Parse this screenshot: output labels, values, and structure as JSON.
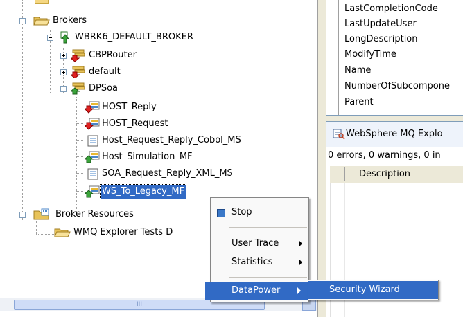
{
  "tree": {
    "brokers_label": "Brokers",
    "broker_name": "WBRK6_DEFAULT_BROKER",
    "groups": [
      "CBPRouter",
      "default",
      "DPSoa"
    ],
    "flows": [
      "HOST_Reply",
      "HOST_Request",
      "Host_Request_Reply_Cobol_MS",
      "Host_Simulation_MF",
      "SOA_Request_Reply_XML_MS",
      "WS_To_Legacy_MF"
    ],
    "broker_resources_label": "Broker Resources",
    "wmq_tests_label": "WMQ Explorer Tests D"
  },
  "properties": [
    "LastCompletionCode",
    "LastUpdateUser",
    "LongDescription",
    "ModifyTime",
    "Name",
    "NumberOfSubcompone",
    "Parent"
  ],
  "problems": {
    "tab_title": "WebSphere MQ Explo",
    "status": "0 errors, 0 warnings, 0 in",
    "col_description": "Description"
  },
  "context_menu": {
    "stop": "Stop",
    "user_trace": "User Trace",
    "statistics": "Statistics",
    "datapower": "DataPower"
  },
  "submenu": {
    "security_wizard": "Security Wizard"
  },
  "scrollbar": {
    "grip": "III"
  },
  "colors": {
    "selection": "#316ac5",
    "panel_border": "#7f9db9",
    "folder": "#f5d782"
  }
}
